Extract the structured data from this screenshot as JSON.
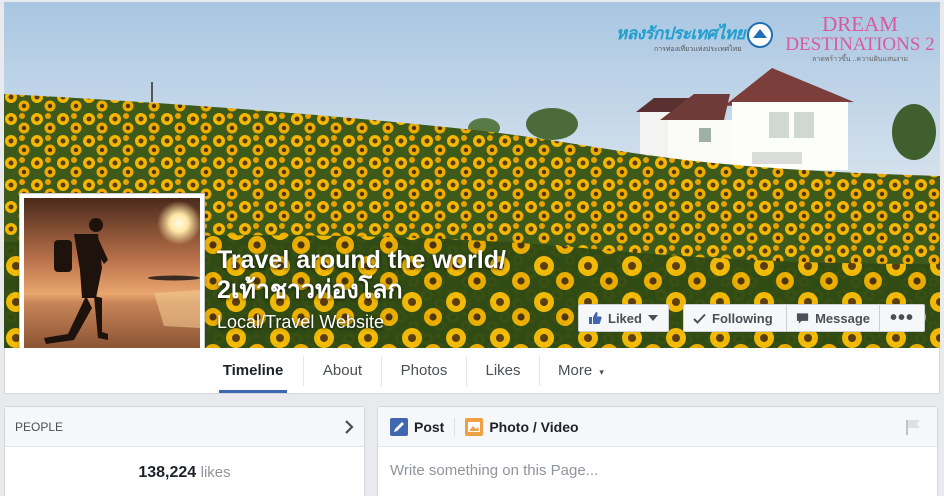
{
  "cover": {
    "logo_left_text": "หลงรักประเทศไทย",
    "logo_left_sub": "การท่องเที่ยวแห่งประเทศไทย",
    "logo_right_line1": "DREAM",
    "logo_right_line2": "DESTINATIONS 2",
    "logo_right_sub": "ลาดพร้าวขึ้น ..ความฝันแสนงาม"
  },
  "page": {
    "title_line1": "Travel around the world/",
    "title_line2": "2เท้าชาวท่องโลก",
    "category": "Local/Travel Website"
  },
  "actions": {
    "liked": "Liked",
    "following": "Following",
    "message": "Message",
    "more_dots": "•••"
  },
  "nav": {
    "tabs": [
      "Timeline",
      "About",
      "Photos",
      "Likes",
      "More"
    ],
    "more_caret": "▾"
  },
  "people": {
    "header": "PEOPLE",
    "likes_count": "138,224",
    "likes_word": "likes"
  },
  "composer": {
    "tab_post": "Post",
    "tab_photo": "Photo / Video",
    "placeholder": "Write something on this Page..."
  },
  "colors": {
    "accent": "#4267b2",
    "sunflower": "#f2b705"
  }
}
